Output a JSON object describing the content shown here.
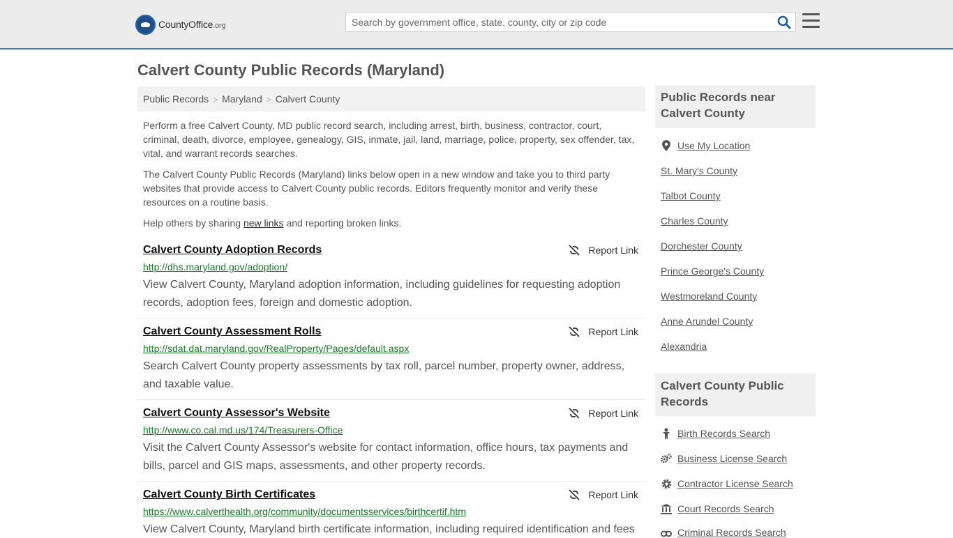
{
  "header": {
    "logo_name": "CountyOffice",
    "logo_tld": ".org",
    "search_placeholder": "Search by government office, state, county, city or zip code"
  },
  "page_title": "Calvert County Public Records (Maryland)",
  "breadcrumb": [
    "Public Records",
    "Maryland",
    "Calvert County"
  ],
  "intro": {
    "p1": "Perform a free Calvert County, MD public record search, including arrest, birth, business, contractor, court, criminal, death, divorce, employee, genealogy, GIS, inmate, jail, land, marriage, police, property, sex offender, tax, vital, and warrant records searches.",
    "p2": "The Calvert County Public Records (Maryland) links below open in a new window and take you to third party websites that provide access to Calvert County public records. Editors frequently monitor and verify these resources on a routine basis.",
    "p3_before": "Help others by sharing ",
    "p3_link": "new links",
    "p3_after": " and reporting broken links."
  },
  "report_label": "Report Link",
  "records": [
    {
      "title": "Calvert County Adoption Records",
      "url": "http://dhs.maryland.gov/adoption/",
      "desc": "View Calvert County, Maryland adoption information, including guidelines for requesting adoption records, adoption fees, foreign and domestic adoption."
    },
    {
      "title": "Calvert County Assessment Rolls",
      "url": "http://sdat.dat.maryland.gov/RealProperty/Pages/default.aspx",
      "desc": "Search Calvert County property assessments by tax roll, parcel number, property owner, address, and taxable value."
    },
    {
      "title": "Calvert County Assessor's Website",
      "url": "http://www.co.cal.md.us/174/Treasurers-Office",
      "desc": "Visit the Calvert County Assessor's website for contact information, office hours, tax payments and bills, parcel and GIS maps, assessments, and other property records."
    },
    {
      "title": "Calvert County Birth Certificates",
      "url": "https://www.calverthealth.org/community/documentsservices/birthcertif.htm",
      "desc": "View Calvert County, Maryland birth certificate information, including required identification and fees"
    }
  ],
  "sidebar": {
    "near_title": "Public Records near Calvert County",
    "near_links": [
      {
        "label": "Use My Location",
        "icon": "location-pin-icon"
      },
      {
        "label": "St. Mary's County"
      },
      {
        "label": "Talbot County"
      },
      {
        "label": "Charles County"
      },
      {
        "label": "Dorchester County"
      },
      {
        "label": "Prince George's County"
      },
      {
        "label": "Westmoreland County"
      },
      {
        "label": "Anne Arundel County"
      },
      {
        "label": "Alexandria"
      }
    ],
    "records_title": "Calvert County Public Records",
    "records_links": [
      {
        "label": "Birth Records Search",
        "icon": "baby-icon"
      },
      {
        "label": "Business License Search",
        "icon": "gears-icon"
      },
      {
        "label": "Contractor License Search",
        "icon": "gear-icon"
      },
      {
        "label": "Court Records Search",
        "icon": "courthouse-icon"
      },
      {
        "label": "Criminal Records Search",
        "icon": "handcuffs-icon"
      }
    ]
  },
  "colors": {
    "accent_border": "#3c7cbf",
    "url_green": "#1c7a2a",
    "search_icon": "#1a5ea8"
  }
}
